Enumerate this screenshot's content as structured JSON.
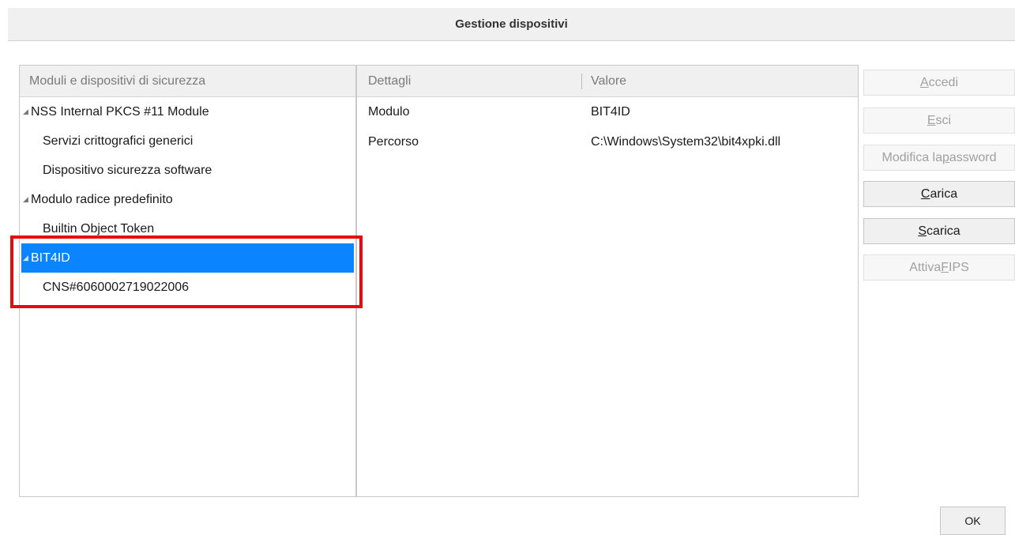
{
  "window": {
    "title": "Gestione dispositivi"
  },
  "tree": {
    "header": "Moduli e dispositivi di sicurezza",
    "items": [
      {
        "label": "NSS Internal PKCS #11 Module",
        "level": 0,
        "expanded": true,
        "selected": false
      },
      {
        "label": "Servizi crittografici generici",
        "level": 1,
        "selected": false
      },
      {
        "label": "Dispositivo sicurezza software",
        "level": 1,
        "selected": false
      },
      {
        "label": "Modulo radice predefinito",
        "level": 0,
        "expanded": true,
        "selected": false
      },
      {
        "label": "Builtin Object Token",
        "level": 1,
        "selected": false
      },
      {
        "label": "BIT4ID",
        "level": 0,
        "expanded": true,
        "selected": true
      },
      {
        "label": "CNS#6060002719022006",
        "level": 1,
        "selected": false
      }
    ]
  },
  "details": {
    "columns": {
      "name": "Dettagli",
      "value": "Valore"
    },
    "rows": [
      {
        "name": "Modulo",
        "value": "BIT4ID"
      },
      {
        "name": "Percorso",
        "value": "C:\\Windows\\System32\\bit4xpki.dll"
      }
    ]
  },
  "buttons": {
    "login": {
      "pre": "",
      "key": "A",
      "post": "ccedi",
      "enabled": false
    },
    "logout": {
      "pre": "",
      "key": "E",
      "post": "sci",
      "enabled": false
    },
    "change_pw": {
      "pre": "Modifica la ",
      "key": "p",
      "post": "assword",
      "enabled": false
    },
    "load": {
      "pre": "",
      "key": "C",
      "post": "arica",
      "enabled": true
    },
    "unload": {
      "pre": "",
      "key": "S",
      "post": "carica",
      "enabled": true
    },
    "fips": {
      "pre": "Attiva ",
      "key": "F",
      "post": "IPS",
      "enabled": false
    },
    "ok": "OK"
  },
  "colors": {
    "selection": "#0a84ff",
    "highlight_box": "#e8090f"
  }
}
